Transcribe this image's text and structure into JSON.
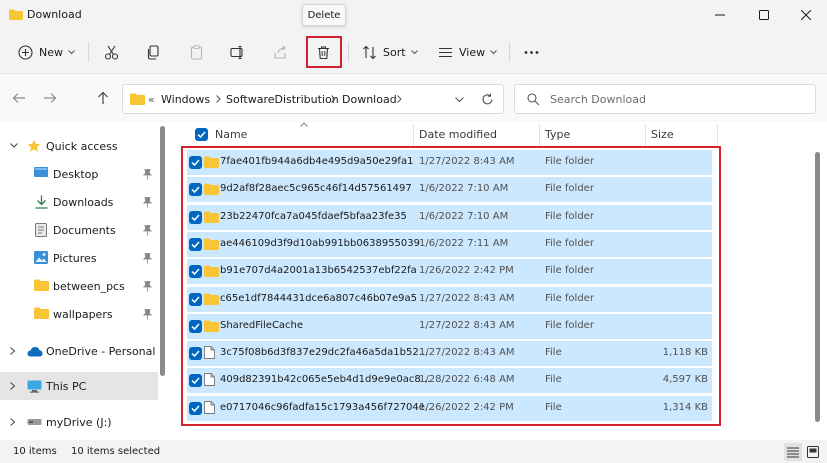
{
  "window": {
    "title": "Download"
  },
  "tooltip": {
    "text": "Delete"
  },
  "toolbar": {
    "new_label": "New",
    "sort_label": "Sort",
    "view_label": "View"
  },
  "address": {
    "crumbs": [
      "Windows",
      "SoftwareDistribution",
      "Download"
    ],
    "overflow": "«"
  },
  "search": {
    "placeholder": "Search Download"
  },
  "nav": {
    "quick_access": "Quick access",
    "items": [
      "Desktop",
      "Downloads",
      "Documents",
      "Pictures",
      "between_pcs",
      "wallpapers"
    ],
    "onedrive": "OneDrive - Personal",
    "thispc": "This PC",
    "mydrive": "myDrive (J:)"
  },
  "columns": {
    "name": "Name",
    "date": "Date modified",
    "type": "Type",
    "size": "Size"
  },
  "files": [
    {
      "name": "7fae401fb944a6db4e495d9a50e29fa1",
      "date": "1/27/2022 8:43 AM",
      "type": "File folder",
      "size": "",
      "kind": "folder"
    },
    {
      "name": "9d2af8f28aec5c965c46f14d57561497",
      "date": "1/6/2022 7:10 AM",
      "type": "File folder",
      "size": "",
      "kind": "folder"
    },
    {
      "name": "23b22470fca7a045fdaef5bfaa23fe35",
      "date": "1/6/2022 7:10 AM",
      "type": "File folder",
      "size": "",
      "kind": "folder"
    },
    {
      "name": "ae446109d3f9d10ab991bb0638955039",
      "date": "1/6/2022 7:11 AM",
      "type": "File folder",
      "size": "",
      "kind": "folder"
    },
    {
      "name": "b91e707d4a2001a13b6542537ebf22fa",
      "date": "1/26/2022 2:42 PM",
      "type": "File folder",
      "size": "",
      "kind": "folder"
    },
    {
      "name": "c65e1df7844431dce6a807c46b07e9a5",
      "date": "1/27/2022 8:43 AM",
      "type": "File folder",
      "size": "",
      "kind": "folder"
    },
    {
      "name": "SharedFileCache",
      "date": "1/27/2022 8:43 AM",
      "type": "File folder",
      "size": "",
      "kind": "folder"
    },
    {
      "name": "3c75f08b6d3f837e29dc2fa46a5da1b52...",
      "date": "1/27/2022 8:43 AM",
      "type": "File",
      "size": "1,118 KB",
      "kind": "file"
    },
    {
      "name": "409d82391b42c065e5eb4d1d9e9e0ac8...",
      "date": "1/28/2022 6:48 AM",
      "type": "File",
      "size": "4,597 KB",
      "kind": "file"
    },
    {
      "name": "e0717046c96fadfa15c1793a456f72704e...",
      "date": "1/26/2022 2:42 PM",
      "type": "File",
      "size": "1,314 KB",
      "kind": "file"
    }
  ],
  "status": {
    "count": "10 items",
    "selected": "10 items selected"
  },
  "colors": {
    "accent": "#0067c0",
    "selection": "#cce8ff",
    "highlight": "#d7232f",
    "folder": "#f8c537"
  }
}
